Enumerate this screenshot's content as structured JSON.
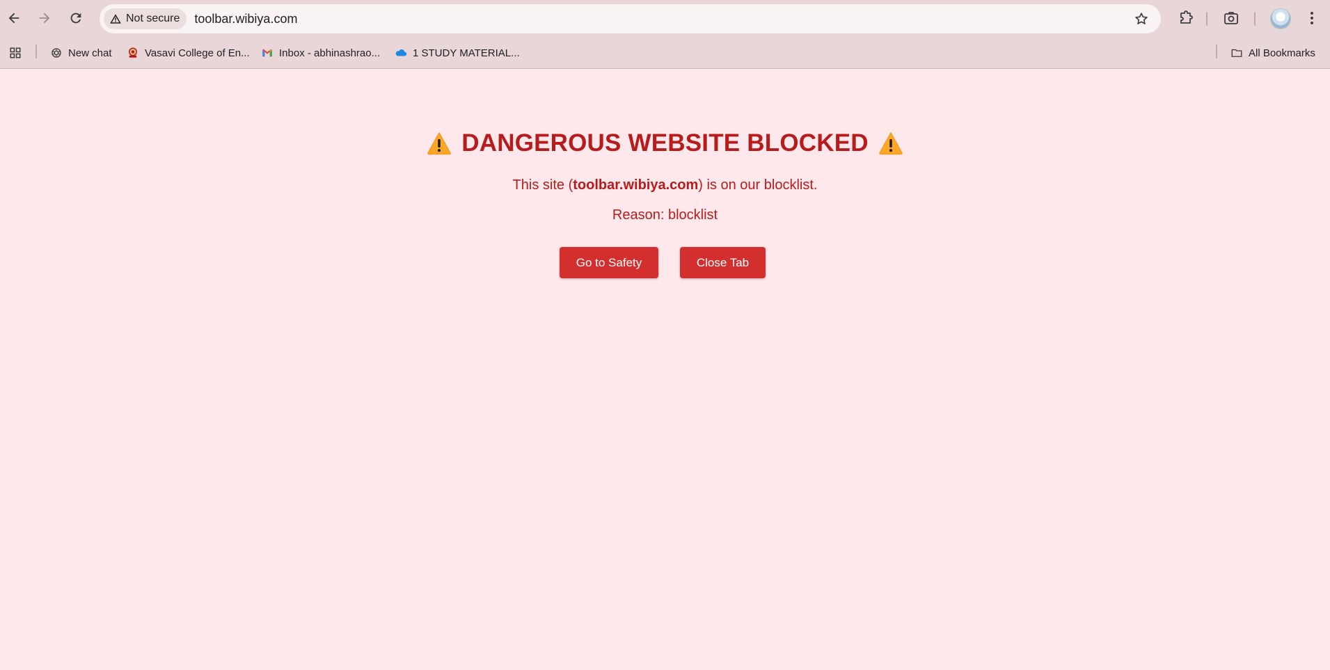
{
  "browser": {
    "security_chip_label": "Not secure",
    "url": "toolbar.wibiya.com",
    "icons": {
      "back": "back-arrow-icon",
      "forward": "forward-arrow-icon",
      "reload": "reload-icon",
      "warning": "warning-triangle-icon",
      "bookmark_star": "star-icon",
      "extensions": "puzzle-icon",
      "screenshot": "camera-icon",
      "profile": "avatar",
      "menu": "kebab-menu-icon"
    }
  },
  "bookmarks": {
    "items": [
      {
        "label": "New chat",
        "icon": "openai-icon"
      },
      {
        "label": "Vasavi College of En...",
        "icon": "college-logo-icon"
      },
      {
        "label": "Inbox - abhinashrao...",
        "icon": "gmail-icon"
      },
      {
        "label": "1 STUDY MATERIAL...",
        "icon": "onedrive-cloud-icon"
      }
    ],
    "all_bookmarks_label": "All Bookmarks"
  },
  "page": {
    "title": "DANGEROUS WEBSITE BLOCKED",
    "site_prefix": "This site (",
    "site_domain": "toolbar.wibiya.com",
    "site_suffix": ") is on our blocklist.",
    "reason": "Reason: blocklist",
    "buttons": {
      "safety": "Go to Safety",
      "close": "Close Tab"
    }
  },
  "colors": {
    "page_background": "#ffe8eb",
    "danger_text": "#b71c1c",
    "button": "#d32f2f",
    "chrome": "#e8d6d8"
  }
}
